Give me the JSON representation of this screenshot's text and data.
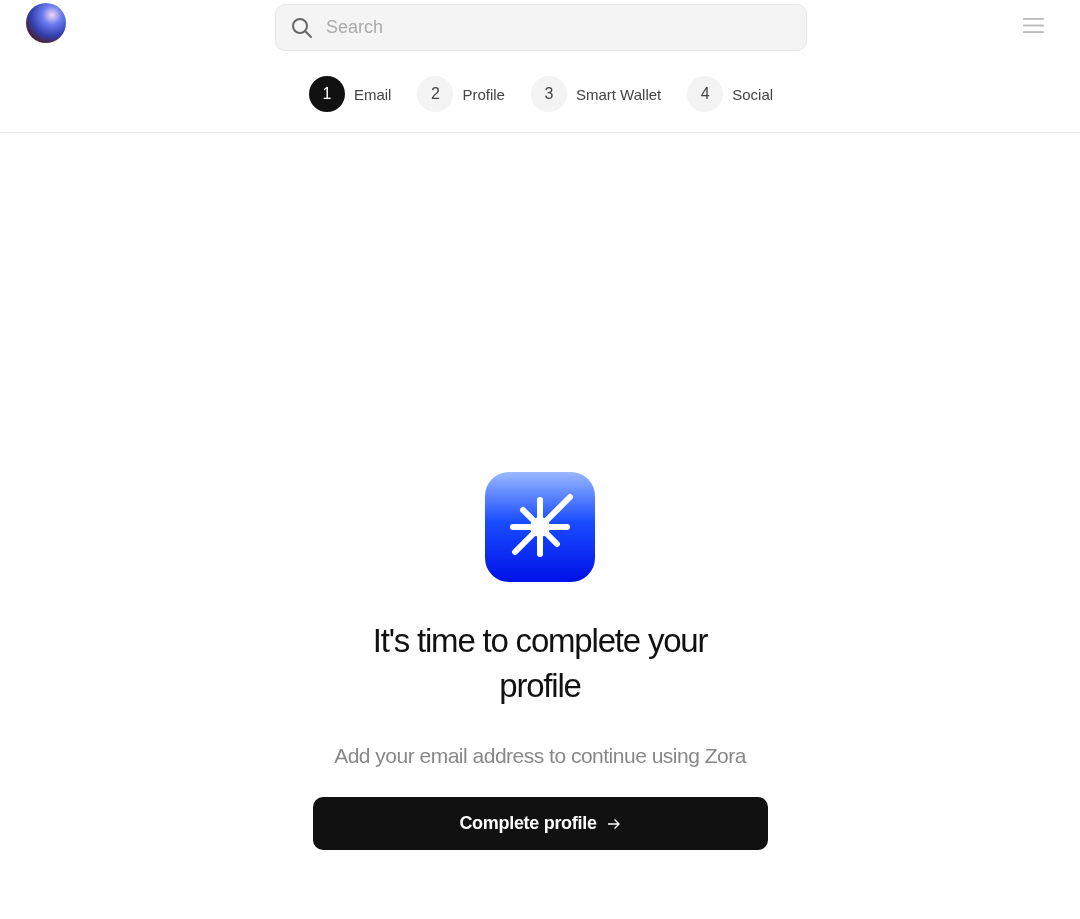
{
  "search": {
    "placeholder": "Search"
  },
  "steps": [
    {
      "number": "1",
      "label": "Email",
      "selected": true
    },
    {
      "number": "2",
      "label": "Profile",
      "selected": false
    },
    {
      "number": "3",
      "label": "Smart Wallet",
      "selected": false
    },
    {
      "number": "4",
      "label": "Social",
      "selected": false
    }
  ],
  "main": {
    "title": "It's time to complete your profile",
    "subtitle": "Add your email address to continue using Zora",
    "button": "Complete profile"
  }
}
